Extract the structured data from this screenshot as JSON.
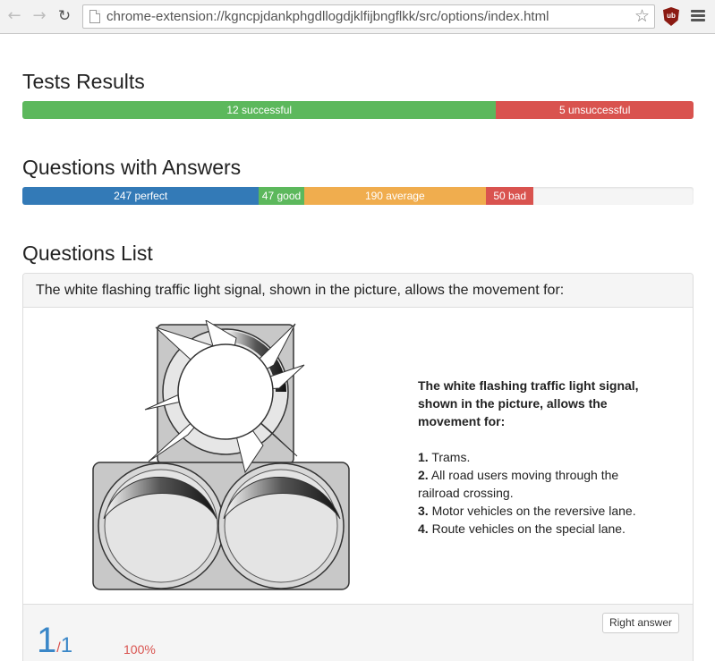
{
  "browser": {
    "url": "chrome-extension://kgncpjdankphgdllogdjklfijbngflkk/src/options/index.html",
    "back_icon": "back-arrow-icon",
    "forward_icon": "forward-arrow-icon",
    "reload_icon": "reload-icon",
    "bookmark_icon": "star-icon",
    "extension_label": "ub",
    "menu_icon": "hamburger-menu-icon"
  },
  "tests": {
    "heading": "Tests Results",
    "bars": [
      {
        "label": "12 successful",
        "value": 12,
        "color": "#5cb85c"
      },
      {
        "label": "5 unsuccessful",
        "value": 5,
        "color": "#d9534f"
      }
    ]
  },
  "answers": {
    "heading": "Questions with Answers",
    "bars": [
      {
        "label": "247 perfect",
        "value": 247,
        "color": "#337ab7"
      },
      {
        "label": "47 good",
        "value": 47,
        "color": "#5cb85c"
      },
      {
        "label": "190 average",
        "value": 190,
        "color": "#f0ad4e"
      },
      {
        "label": "50 bad",
        "value": 50,
        "color": "#d9534f"
      }
    ],
    "filled_fraction": 0.762
  },
  "list": {
    "heading": "Questions List",
    "question": {
      "title": "The white flashing traffic light signal, shown in the picture, allows the movement for:",
      "body_title": "The white flashing traffic light signal, shown in the picture, allows the movement for:",
      "options": [
        {
          "num": "1.",
          "text": "Trams."
        },
        {
          "num": "2.",
          "text": "All road users moving through the railroad crossing."
        },
        {
          "num": "3.",
          "text": "Motor vehicles on the reversive lane."
        },
        {
          "num": "4.",
          "text": "Route vehicles on the special lane."
        }
      ],
      "right_answer_label": "Right answer",
      "score_current": "1",
      "score_slash": "/",
      "score_total": "1",
      "percent": "100%"
    }
  }
}
